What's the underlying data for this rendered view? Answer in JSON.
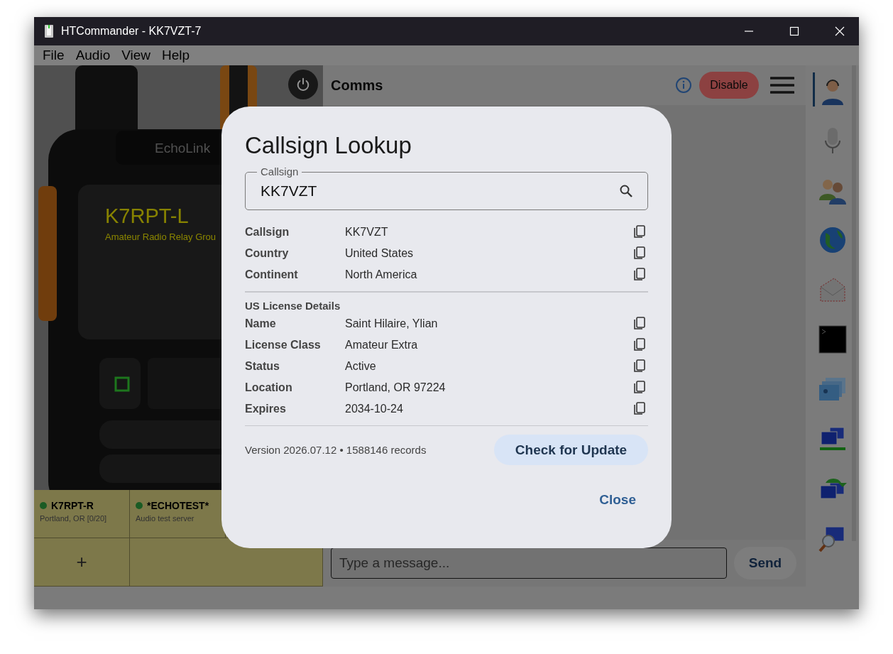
{
  "window": {
    "title": "HTCommander - KK7VZT-7"
  },
  "menu": [
    "File",
    "Audio",
    "View",
    "Help"
  ],
  "radio": {
    "label": "EchoLink",
    "display_title": "K7RPT-L",
    "display_subtitle": "Amateur Radio Relay Grou"
  },
  "channels": [
    {
      "name": "K7RPT-R",
      "detail": "Portland, OR [0/20]",
      "online": true
    },
    {
      "name": "*ECHOTEST*",
      "detail": "Audio test server",
      "online": true
    }
  ],
  "add_button": "+",
  "comms": {
    "title": "Comms",
    "disable_button": "Disable",
    "message": {
      "placeholder": "Type a message..."
    },
    "send_button": "Send"
  },
  "sidebar": {
    "items": [
      {
        "kind": "operator",
        "selected": true
      },
      {
        "kind": "microphone",
        "selected": false
      },
      {
        "kind": "contacts",
        "selected": false
      },
      {
        "kind": "globe",
        "selected": false
      },
      {
        "kind": "mail",
        "selected": false
      },
      {
        "kind": "terminal",
        "selected": false
      },
      {
        "kind": "windows",
        "selected": false
      },
      {
        "kind": "network",
        "selected": false
      },
      {
        "kind": "transfer",
        "selected": false
      },
      {
        "kind": "inspect",
        "selected": false
      }
    ]
  },
  "dialog": {
    "title": "Callsign Lookup",
    "field": {
      "label": "Callsign",
      "value": "KK7VZT"
    },
    "rows": [
      {
        "label": "Callsign",
        "value": "KK7VZT"
      },
      {
        "label": "Country",
        "value": "United States"
      },
      {
        "label": "Continent",
        "value": "North America"
      }
    ],
    "section_title": "US License Details",
    "license_rows": [
      {
        "label": "Name",
        "value": "Saint Hilaire, Ylian"
      },
      {
        "label": "License Class",
        "value": "Amateur Extra"
      },
      {
        "label": "Status",
        "value": "Active"
      },
      {
        "label": "Location",
        "value": "Portland, OR 97224"
      },
      {
        "label": "Expires",
        "value": "2034-10-24"
      }
    ],
    "version": "Version 2026.07.12 • 1588146 records",
    "update_button": "Check for Update",
    "close_button": "Close"
  }
}
